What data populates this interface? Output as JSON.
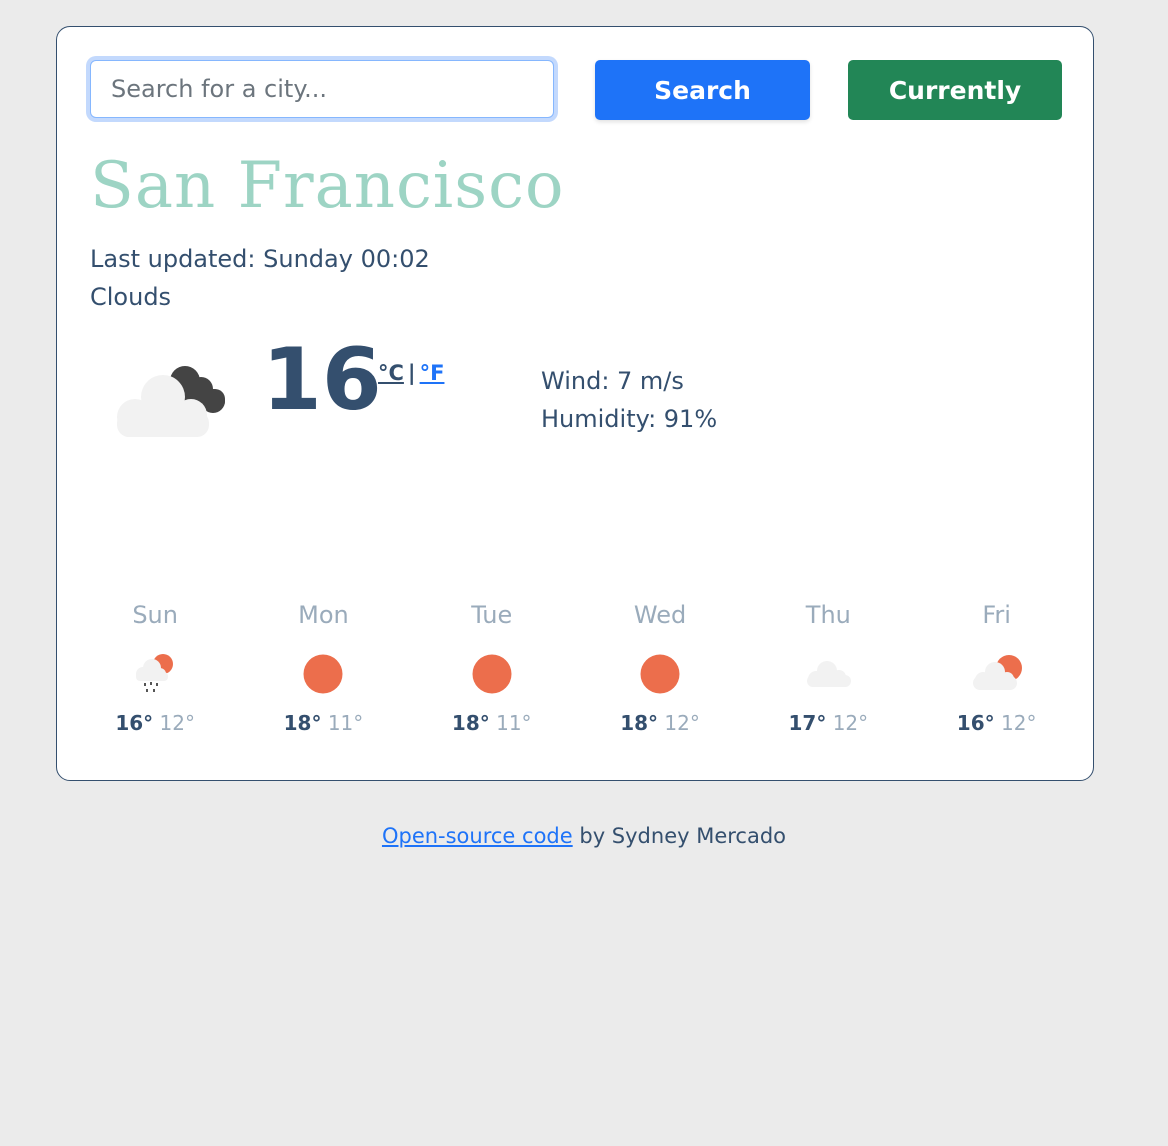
{
  "search": {
    "placeholder": "Search for a city...",
    "value": ""
  },
  "buttons": {
    "search_label": "Search",
    "current_label": "Currently"
  },
  "current": {
    "city": "San Francisco",
    "last_updated": "Last updated: Sunday 00:02",
    "description": "Clouds",
    "icon": "broken-clouds-icon",
    "temperature": "16",
    "unit_celsius": "°C",
    "unit_separator": "|",
    "unit_fahrenheit": "°F",
    "wind": "Wind: 7 m/s",
    "humidity": "Humidity: 91%"
  },
  "forecast": [
    {
      "day": "Sun",
      "icon": "rain-sun-icon",
      "high": "16°",
      "low": "12°"
    },
    {
      "day": "Mon",
      "icon": "sun-icon",
      "high": "18°",
      "low": "11°"
    },
    {
      "day": "Tue",
      "icon": "sun-icon",
      "high": "18°",
      "low": "11°"
    },
    {
      "day": "Wed",
      "icon": "sun-icon",
      "high": "18°",
      "low": "12°"
    },
    {
      "day": "Thu",
      "icon": "cloud-icon",
      "high": "17°",
      "low": "12°"
    },
    {
      "day": "Fri",
      "icon": "cloud-sun-icon",
      "high": "16°",
      "low": "12°"
    }
  ],
  "footer": {
    "link_text": "Open-source code",
    "text": " by Sydney Mercado"
  },
  "colors": {
    "primary": "#1e73f8",
    "success": "#228656",
    "city": "#9dd4c4",
    "text": "#344f6e",
    "muted": "#9aabbb",
    "sun": "#ec6e4c"
  }
}
